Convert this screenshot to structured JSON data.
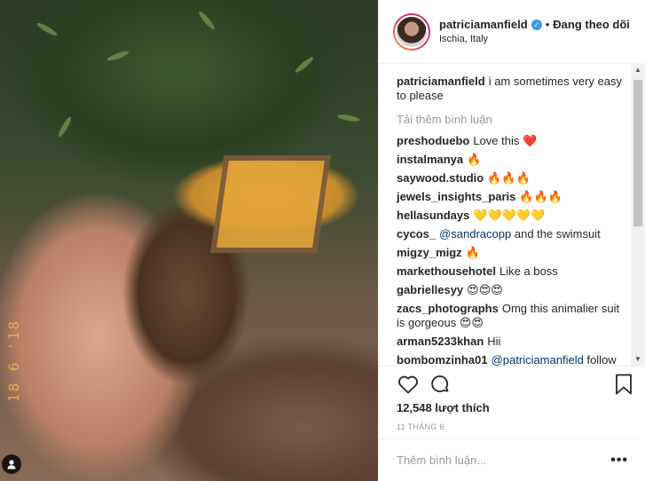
{
  "photo": {
    "date_stamp": "18 6 '18",
    "user_tag_icon": "person-icon"
  },
  "header": {
    "username": "patriciamanfield",
    "verified_icon": "verified-badge-icon",
    "separator": "•",
    "follow_label": "Đang theo dõi",
    "location": "Ischia, Italy"
  },
  "caption": {
    "author": "patriciamanfield",
    "text": "i am sometimes very easy to please"
  },
  "load_more": "Tải thêm bình luận",
  "comments": [
    {
      "author": "preshoduebo",
      "text": "Love this ❤️",
      "mention": ""
    },
    {
      "author": "instalmanya",
      "text": "🔥",
      "mention": ""
    },
    {
      "author": "saywood.studio",
      "text": "🔥🔥🔥",
      "mention": ""
    },
    {
      "author": "jewels_insights_paris",
      "text": "🔥🔥🔥",
      "mention": ""
    },
    {
      "author": "hellasundays",
      "text": "💛💛💛💛💛",
      "mention": ""
    },
    {
      "author": "cycos_",
      "mention": "@sandracopp",
      "text": "and the swimsuit"
    },
    {
      "author": "migzy_migz",
      "text": "🔥",
      "mention": ""
    },
    {
      "author": "markethousehotel",
      "text": "Like a boss",
      "mention": ""
    },
    {
      "author": "gabriellesyy",
      "text": "😍😍😍",
      "mention": ""
    },
    {
      "author": "zacs_photographs",
      "text": "Omg this animalier suit is gorgeous 😍😍",
      "mention": ""
    },
    {
      "author": "arman5233khan",
      "text": "Hii",
      "mention": ""
    },
    {
      "author": "bombomzinha01",
      "mention": "@patriciamanfield",
      "text": "follow"
    }
  ],
  "actions": {
    "like_icon": "heart-icon",
    "comment_icon": "comment-icon",
    "save_icon": "bookmark-icon"
  },
  "likes_text": "12,548 lượt thích",
  "timestamp": "11 THÁNG 6",
  "add_comment": {
    "placeholder": "Thêm bình luận...",
    "more_label": "•••"
  },
  "colors": {
    "link": "#003569",
    "verified": "#3897f0",
    "muted": "#999999"
  }
}
